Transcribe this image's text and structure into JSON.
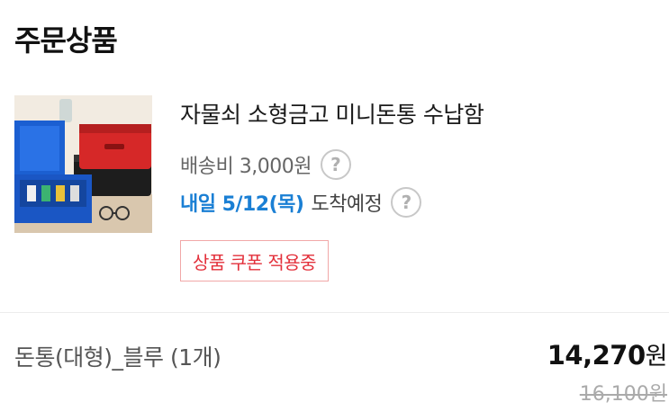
{
  "section": {
    "title": "주문상품"
  },
  "product": {
    "name": "자물쇠 소형금고 미니돈통 수납함",
    "image_alt": "금고 상품 이미지",
    "shipping_label": "배송비 3,000원",
    "arrival_date": "내일 5/12(목)",
    "arrival_label": "도착예정",
    "coupon_badge": "상품 쿠폰 적용중"
  },
  "option": {
    "text": "돈통(대형)_블루 (1개)",
    "price": "14,270",
    "price_unit": "원",
    "original_price": "16,100원"
  },
  "icons": {
    "help": "question-circle-icon"
  },
  "colors": {
    "arrival_blue": "#1a7fd4",
    "coupon_red": "#e3303b",
    "coupon_border": "#f1a8a8"
  }
}
